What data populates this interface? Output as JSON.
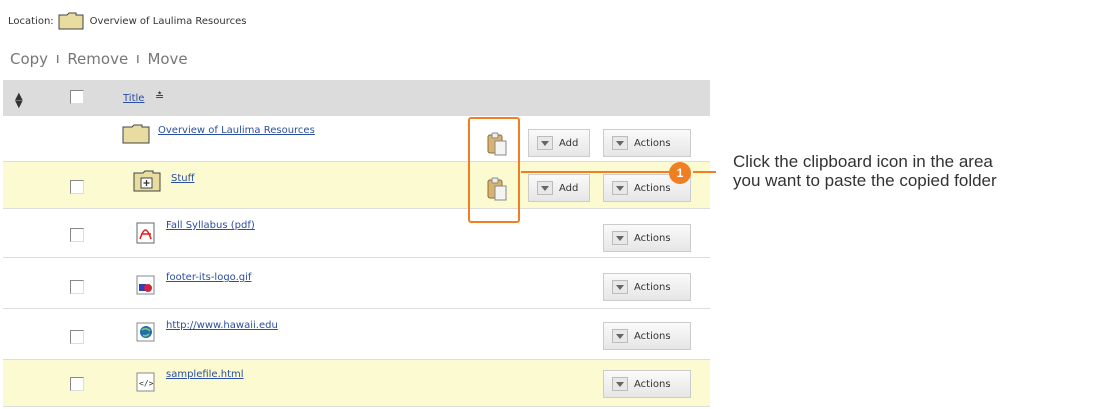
{
  "location": {
    "label": "Location:",
    "path": "Overview of Laulima Resources"
  },
  "toolbar": {
    "copy": "Copy",
    "remove": "Remove",
    "move": "Move",
    "separator": "I"
  },
  "table": {
    "title_header": "Title",
    "add_label": "Add",
    "actions_label": "Actions",
    "rows": [
      {
        "name": "Overview of Laulima Resources",
        "icon": "folder-icon"
      },
      {
        "name": "Stuff",
        "icon": "folder-plus-icon"
      },
      {
        "name": "Fall Syllabus (pdf)",
        "icon": "pdf-icon"
      },
      {
        "name": "footer-its-logo.gif",
        "icon": "image-icon"
      },
      {
        "name": "http://www.hawaii.edu",
        "icon": "web-link-icon"
      },
      {
        "name": "samplefile.html",
        "icon": "html-file-icon"
      }
    ]
  },
  "callout": {
    "number": "1",
    "line1": "Click the clipboard icon in the area",
    "line2": "you want to paste the copied folder"
  },
  "colors": {
    "highlight_row": "#fcfad0",
    "callout": "#f07e22",
    "link": "#2a4ea0",
    "header_bg": "#dcdcdc"
  }
}
